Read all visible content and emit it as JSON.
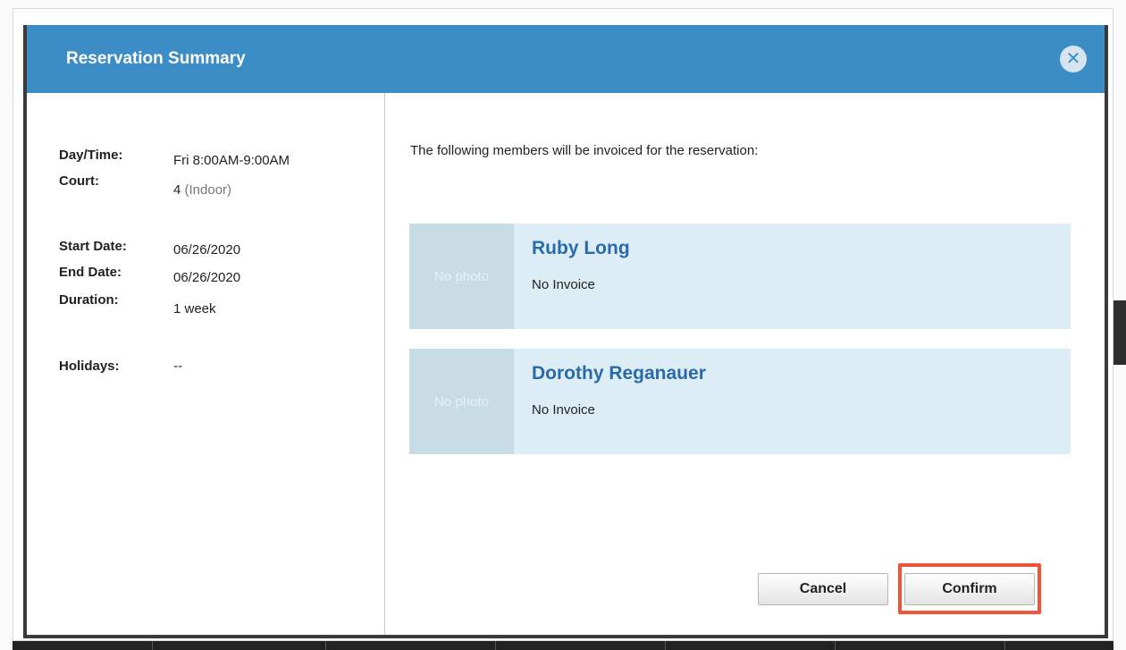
{
  "modal": {
    "title": "Reservation Summary",
    "close_icon": "close-icon"
  },
  "details": {
    "day_time_label": "Day/Time:",
    "day_time_value": "Fri 8:00AM-9:00AM",
    "court_label": "Court:",
    "court_number": "4",
    "court_type": "(Indoor)",
    "start_date_label": "Start Date:",
    "start_date_value": "06/26/2020",
    "end_date_label": "End Date:",
    "end_date_value": "06/26/2020",
    "duration_label": "Duration:",
    "duration_value": "1 week",
    "holidays_label": "Holidays:",
    "holidays_value": "--"
  },
  "invoice": {
    "intro": "The following members will be invoiced for the reservation:",
    "members": [
      {
        "photo": "No photo",
        "name": "Ruby Long",
        "status": "No Invoice"
      },
      {
        "photo": "No photo",
        "name": "Dorothy Reganauer",
        "status": "No Invoice"
      }
    ]
  },
  "actions": {
    "cancel_label": "Cancel",
    "confirm_label": "Confirm"
  },
  "colors": {
    "header": "#3c8cc6",
    "card": "#ddedf5",
    "highlight": "#f0523a"
  }
}
